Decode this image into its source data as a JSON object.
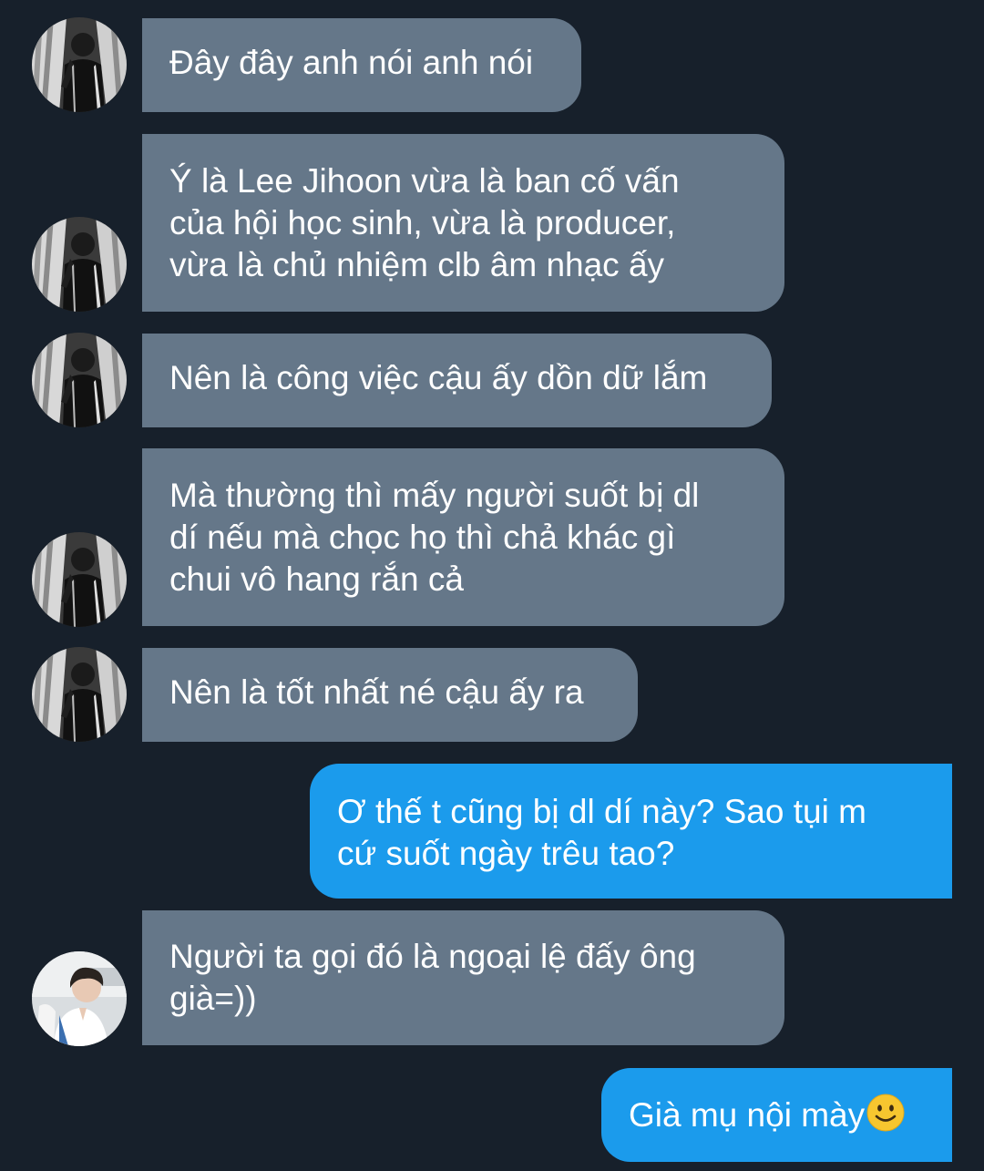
{
  "colors": {
    "background": "#17202b",
    "incoming_bubble": "#657789",
    "outgoing_bubble": "#1b9bec",
    "text": "#ffffff"
  },
  "messages": [
    {
      "direction": "incoming",
      "avatar": "avatar-a",
      "text": "Đây đây anh nói anh nói"
    },
    {
      "direction": "incoming",
      "avatar": "avatar-a",
      "lines": [
        "Ý là Lee Jihoon vừa là ban cố vấn",
        "của hội học sinh, vừa là producer,",
        "vừa là chủ nhiệm clb âm nhạc ấy"
      ]
    },
    {
      "direction": "incoming",
      "avatar": "avatar-a",
      "text": "Nên là công việc cậu ấy dồn dữ lắm"
    },
    {
      "direction": "incoming",
      "avatar": "avatar-a",
      "lines": [
        "Mà thường thì mấy người suốt bị dl",
        "dí nếu mà chọc họ thì chả khác gì",
        "chui vô hang rắn cả"
      ]
    },
    {
      "direction": "incoming",
      "avatar": "avatar-a",
      "text": "Nên là tốt nhất né cậu ấy ra"
    },
    {
      "direction": "outgoing",
      "lines": [
        "Ơ thế t cũng bị dl dí này? Sao tụi m",
        "cứ suốt ngày trêu tao?"
      ]
    },
    {
      "direction": "incoming",
      "avatar": "avatar-b",
      "lines": [
        "Người ta gọi đó là ngoại lệ đấy ông",
        "già=))"
      ]
    },
    {
      "direction": "outgoing",
      "text": "Già mụ nội mày",
      "emoji": "slightly-smiling-face-emoji"
    }
  ]
}
